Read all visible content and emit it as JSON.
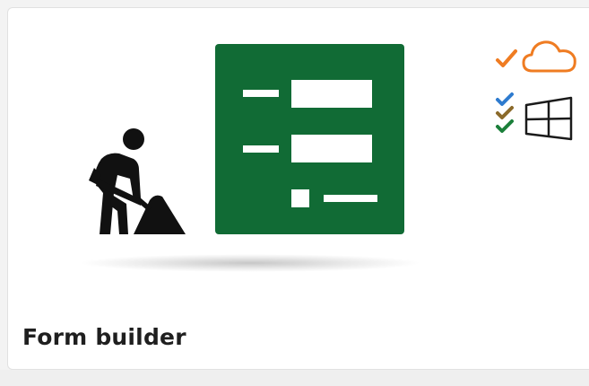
{
  "card": {
    "title": "Form builder"
  },
  "icons": {
    "worker": "construction-worker-icon",
    "form": "form-document-icon",
    "cloud_check": "cloud-check-icon",
    "windows_check": "windows-check-icon"
  },
  "colors": {
    "form_green": "#116b35",
    "cloud_orange": "#ef7c22",
    "check_blue": "#2e7bcf",
    "check_brown": "#8b6a2b",
    "check_green": "#1b7f3a",
    "text": "#1f1f1f"
  }
}
